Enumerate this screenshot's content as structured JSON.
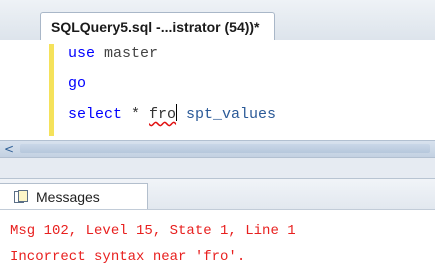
{
  "document_tab": {
    "title": "SQLQuery5.sql -...istrator (54))*"
  },
  "editor": {
    "line1": {
      "keyword": "use",
      "text": " master"
    },
    "line2": {
      "keyword": "go"
    },
    "line3": {
      "keyword": "select",
      "mid": " * ",
      "error_token": "fro",
      "after": " spt_values"
    }
  },
  "scrollbar": {
    "left_arrow_glyph": "<"
  },
  "results": {
    "tab_label": "Messages",
    "messages": [
      "Msg 102, Level 15, State 1, Line 1",
      "Incorrect syntax near 'fro'."
    ]
  },
  "colors": {
    "keyword": "#0000ff",
    "error_text": "#e8201f",
    "change_marker": "#f5e25b"
  },
  "icons": {
    "messages_tab_icon": "messages-icon"
  }
}
